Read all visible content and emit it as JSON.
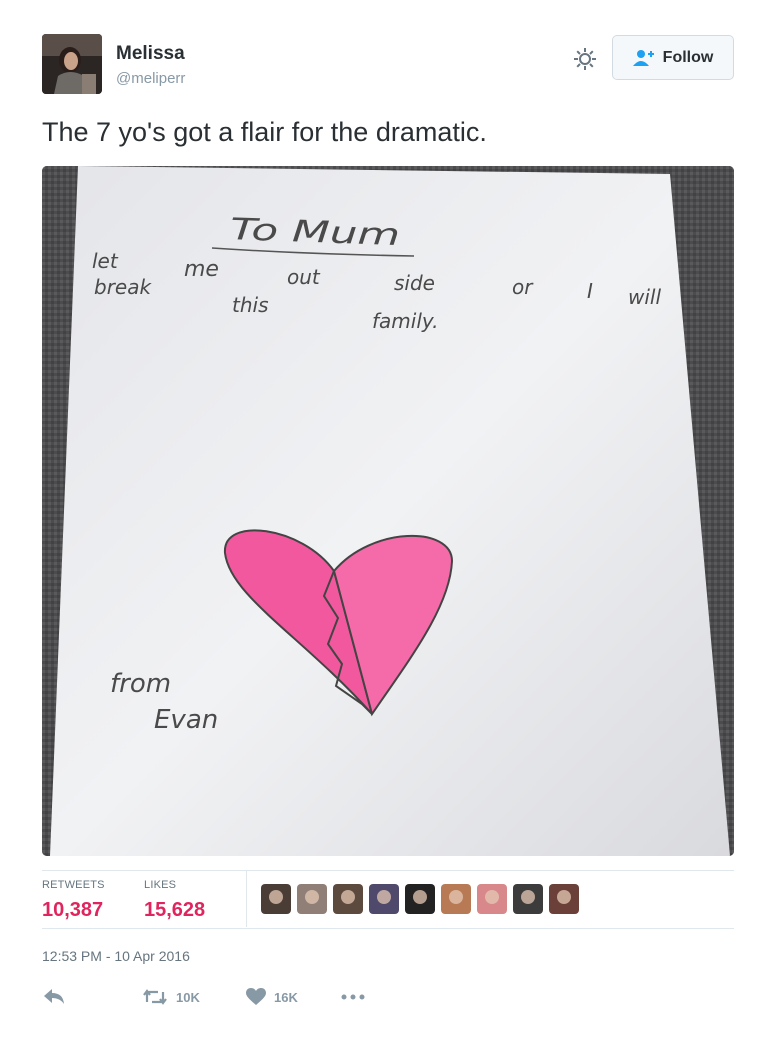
{
  "user": {
    "name": "Melissa",
    "handle": "@meliperr"
  },
  "follow_button": {
    "label": "Follow",
    "icon": "follow-person-icon"
  },
  "settings": {
    "icon": "gear-icon"
  },
  "tweet": {
    "text": "The 7 yo's got a flair for the dramatic."
  },
  "photo": {
    "drawing": {
      "heading": "To Mum",
      "lines": [
        [
          "let",
          "me",
          "out",
          "side",
          "or",
          "I",
          "will"
        ],
        [
          "break",
          "this",
          "family."
        ]
      ],
      "signoff": [
        "from",
        "Evan"
      ],
      "heart_color": "#f2589e"
    }
  },
  "stats": {
    "retweets_label": "RETWEETS",
    "retweets_value": "10,387",
    "likes_label": "LIKES",
    "likes_value": "15,628"
  },
  "liker_avatars": [
    "#4a3d36",
    "#8f7f76",
    "#5d4a3e",
    "#4f4a6c",
    "#222222",
    "#b77a55",
    "#d8878b",
    "#3c3c3c",
    "#6a4038"
  ],
  "timestamp": "12:53 PM - 10 Apr 2016",
  "actions": {
    "reply_icon": "reply-icon",
    "retweet_icon": "retweet-icon",
    "retweet_count": "10K",
    "like_icon": "heart-icon",
    "like_count": "16K",
    "more_icon": "more-icon"
  },
  "colors": {
    "accent": "#e0245e",
    "text": "#292f33",
    "muted": "#8899a6"
  }
}
